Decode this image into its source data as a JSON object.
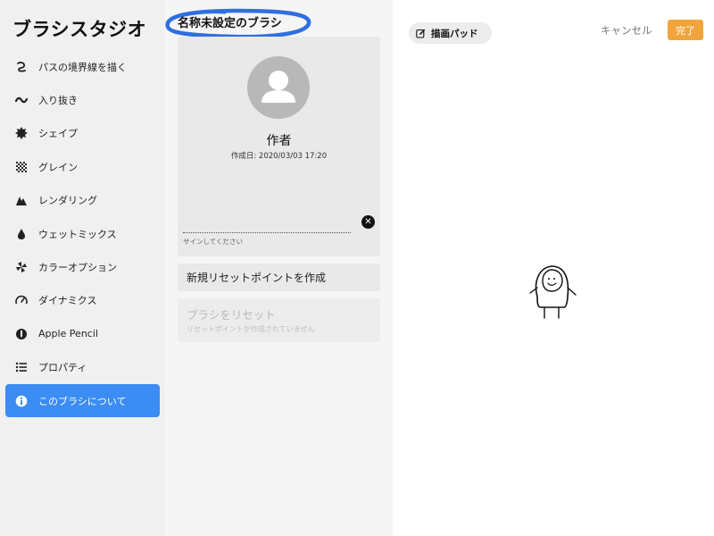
{
  "app": {
    "title": "ブラシスタジオ"
  },
  "sidebar": {
    "items": [
      {
        "label": "パスの境界線を描く",
        "icon": "stroke-path-icon"
      },
      {
        "label": "入り抜き",
        "icon": "taper-wave-icon"
      },
      {
        "label": "シェイプ",
        "icon": "shape-icon"
      },
      {
        "label": "グレイン",
        "icon": "grain-icon"
      },
      {
        "label": "レンダリング",
        "icon": "rendering-icon"
      },
      {
        "label": "ウェットミックス",
        "icon": "droplet-icon"
      },
      {
        "label": "カラーオプション",
        "icon": "pinwheel-icon"
      },
      {
        "label": "ダイナミクス",
        "icon": "gauge-icon"
      },
      {
        "label": "Apple Pencil",
        "icon": "pencil-icon"
      },
      {
        "label": "プロパティ",
        "icon": "list-icon"
      },
      {
        "label": "このブラシについて",
        "icon": "info-icon",
        "active": true
      }
    ]
  },
  "about": {
    "brush_name": "名称未設定のブラシ",
    "author": "作者",
    "created": "作成日: 2020/03/03 17:20",
    "sign_hint": "サインしてください",
    "create_reset_point": "新規リセットポイントを作成",
    "reset_brush": "ブラシをリセット",
    "reset_note": "リセットポイントが作成されていません"
  },
  "pad": {
    "tab_label": "描画パッド",
    "cancel": "キャンセル",
    "done": "完了"
  },
  "colors": {
    "accent": "#3b8cf3",
    "done": "#f0a53c",
    "highlight_ring": "#2f6fe0"
  }
}
